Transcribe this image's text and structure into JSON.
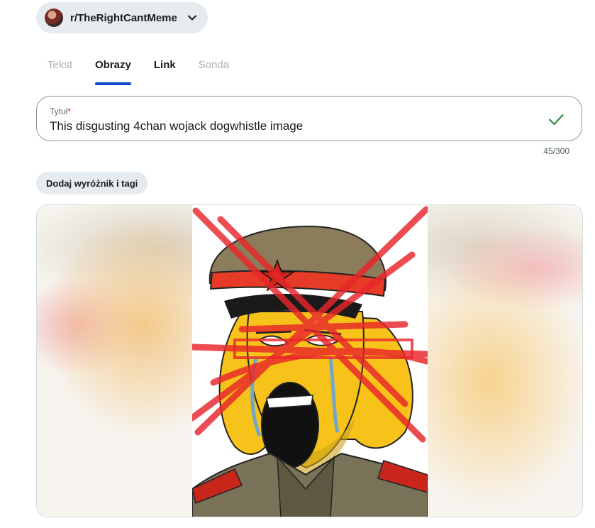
{
  "community": {
    "name": "r/TheRightCantMeme",
    "avatar_icon": "community-avatar",
    "dropdown_icon": "chevron-down-icon"
  },
  "tabs": [
    {
      "label": "Tekst",
      "state": "disabled"
    },
    {
      "label": "Obrazy",
      "state": "active"
    },
    {
      "label": "Link",
      "state": "enabled"
    },
    {
      "label": "Sonda",
      "state": "disabled"
    }
  ],
  "title_field": {
    "label": "Tytuł",
    "required_marker": "*",
    "value": "This disgusting 4chan wojack dogwhistle image",
    "valid_icon": "check-icon",
    "counter": "45/300"
  },
  "flair_button": {
    "label": "Dodaj wyróżnik i tagi"
  },
  "colors": {
    "accent": "#0a4bc8",
    "valid": "#2e8b3a",
    "pill_bg": "#e5ebee",
    "required": "#d93a00"
  }
}
